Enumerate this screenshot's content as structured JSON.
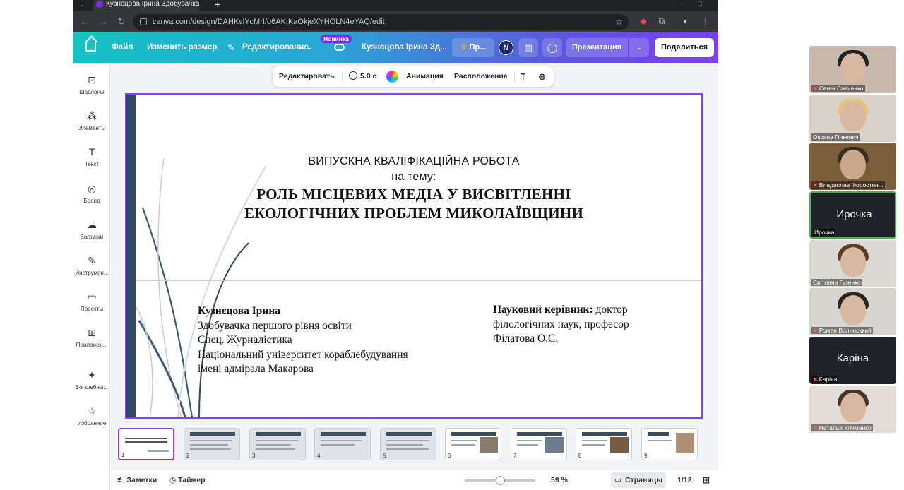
{
  "browser": {
    "tab_title": "Кузнєцова Ірина Здобувачка п",
    "url": "canva.com/design/DAHKvlYcMrI/o6AKIKaOkjeXYHOLN4eYAQ/edit"
  },
  "topbar": {
    "file": "Файл",
    "resize": "Изменить размер",
    "editing": "Редактирование",
    "new_badge": "Новинка",
    "design_title": "Кузнєцова Ірина Зд...",
    "pro": "Пр...",
    "avatar": "N",
    "present": "Презентация",
    "share": "Поделиться"
  },
  "rail": {
    "items": [
      {
        "label": "Шаблоны",
        "icon": "templates-icon"
      },
      {
        "label": "Элементы",
        "icon": "elements-icon"
      },
      {
        "label": "Текст",
        "icon": "text-icon"
      },
      {
        "label": "Бренд",
        "icon": "brand-icon"
      },
      {
        "label": "Загрузки",
        "icon": "uploads-icon"
      },
      {
        "label": "Инструмен...",
        "icon": "tools-icon"
      },
      {
        "label": "Проекты",
        "icon": "projects-icon"
      },
      {
        "label": "Приложен...",
        "icon": "apps-icon"
      },
      {
        "label": "Волшебны...",
        "icon": "magic-icon"
      },
      {
        "label": "Избранное",
        "icon": "star-icon"
      }
    ]
  },
  "context_toolbar": {
    "edit": "Редактировать",
    "duration": "5.0 с",
    "animation": "Анимация",
    "position": "Расположение"
  },
  "slide": {
    "line1": "ВИПУСКНА КВАЛІФІКАЦІЙНА РОБОТА",
    "line2": "на тему:",
    "title1": "РОЛЬ МІСЦЕВИХ МЕДІА У ВИСВІТЛЕННІ",
    "title2": "ЕКОЛОГІЧНИХ ПРОБЛЕМ МИКОЛАЇВЩИНИ",
    "author_name": "Кузнєцова Ірина",
    "author_l1": "Здобувачка першого рівня освіти",
    "author_l2": "Спец. Журналістика",
    "author_l3": "Національний університет кораблебудування",
    "author_l4": "імені адмірала Макарова",
    "supervisor_label": "Науковий керівник:",
    "supervisor_l1": " доктор",
    "supervisor_l2": "філологічних наук, професор",
    "supervisor_l3": "Філатова О.С."
  },
  "filmstrip": {
    "pages": [
      "1",
      "2",
      "3",
      "4",
      "5",
      "6",
      "7",
      "8",
      "9"
    ]
  },
  "statusbar": {
    "notes": "Заметки",
    "timer": "Таймер",
    "zoom": "59 %",
    "pages": "Страницы",
    "page_count": "1/12"
  },
  "participants": [
    {
      "name": "Євген Савченко",
      "muted": true
    },
    {
      "name": "Оксана Гінкевич",
      "muted": false
    },
    {
      "name": "Владислав Форостян...",
      "muted": true
    },
    {
      "name": "Ирочка",
      "label": "Ирочка",
      "muted": false
    },
    {
      "name": "Світлана Гузенко",
      "muted": false
    },
    {
      "name": "Роман Волинський",
      "muted": true
    },
    {
      "name": "Каріна",
      "label": "Каріна",
      "muted": true
    },
    {
      "name": "Наталья Клименко",
      "muted": true
    }
  ],
  "colors": {
    "accent": "#8b3dff",
    "slide_bar": "#2f4a63"
  }
}
